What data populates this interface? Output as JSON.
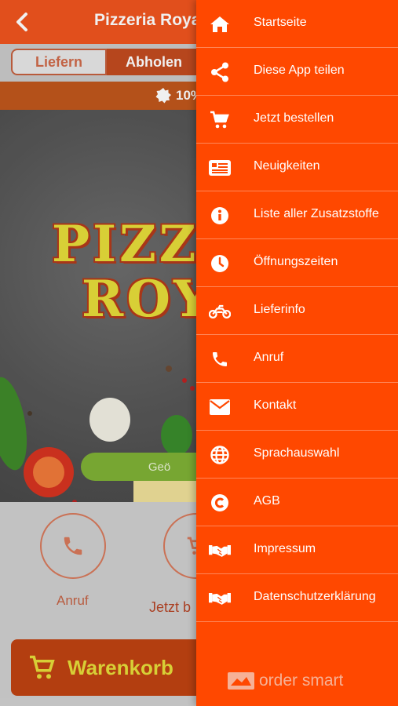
{
  "header": {
    "title": "Pizzeria Royal C"
  },
  "order_mode": {
    "delivery_label": "Liefern",
    "pickup_label": "Abholen"
  },
  "promo": {
    "text": "10%"
  },
  "hero": {
    "logo_line1": "PIZZE",
    "logo_line2": "ROY",
    "pill_text": "Geö"
  },
  "actions": {
    "call_label": "Anruf",
    "order_label": "Jetzt b"
  },
  "cart": {
    "label": "Warenkorb"
  },
  "menu": {
    "items": [
      {
        "label": "Startseite",
        "icon": "home-icon"
      },
      {
        "label": "Diese App teilen",
        "icon": "share-icon"
      },
      {
        "label": "Jetzt bestellen",
        "icon": "cart-icon"
      },
      {
        "label": "Neuigkeiten",
        "icon": "news-icon"
      },
      {
        "label": "Liste aller Zusatzstoffe",
        "icon": "info-icon"
      },
      {
        "label": "Öffnungszeiten",
        "icon": "clock-icon"
      },
      {
        "label": "Lieferinfo",
        "icon": "motorcycle-icon"
      },
      {
        "label": "Anruf",
        "icon": "phone-icon"
      },
      {
        "label": "Kontakt",
        "icon": "mail-icon"
      },
      {
        "label": "Sprachauswahl",
        "icon": "globe-icon"
      },
      {
        "label": "AGB",
        "icon": "copyright-icon"
      },
      {
        "label": "Impressum",
        "icon": "handshake-icon"
      },
      {
        "label": "Datenschutzerklärung",
        "icon": "handshake-icon"
      }
    ],
    "brand": "order smart"
  },
  "colors": {
    "drawer": "#ff4800",
    "topbar": "#f0541e",
    "cart": "#bf4212",
    "logo_yellow": "#e6dc3a",
    "pill_green": "#7fb136"
  }
}
